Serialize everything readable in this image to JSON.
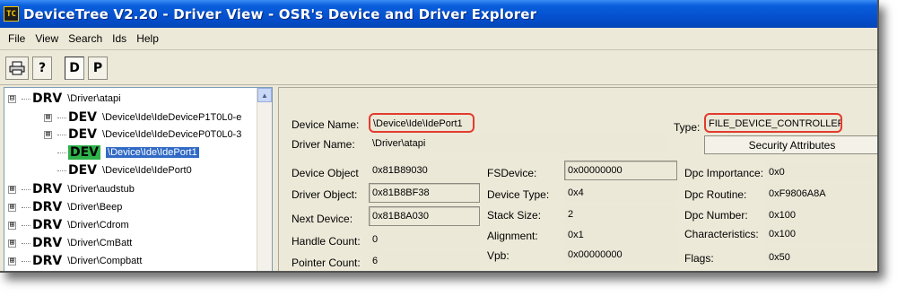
{
  "window": {
    "icon_text": "TC",
    "title": "DeviceTree V2.20 - Driver View - OSR's Device and Driver Explorer"
  },
  "menu": [
    "File",
    "View",
    "Search",
    "Ids",
    "Help"
  ],
  "toolbar": {
    "print_icon": "printer-icon",
    "help_label": "?",
    "driver_view_label": "D",
    "pnp_view_label": "P"
  },
  "tree": {
    "items": [
      {
        "expander": "⊟",
        "kind": "DRV",
        "path": "\\Driver\\atapi"
      },
      {
        "expander": "⊞",
        "kind": "DEV",
        "path": "\\Device\\Ide\\IdeDeviceP1T0L0-e"
      },
      {
        "expander": "⊞",
        "kind": "DEV",
        "path": "\\Device\\Ide\\IdeDeviceP0T0L0-3"
      },
      {
        "expander": "",
        "kind": "DEV",
        "path": "\\Device\\Ide\\IdePort1"
      },
      {
        "expander": "",
        "kind": "DEV",
        "path": "\\Device\\Ide\\IdePort0"
      },
      {
        "expander": "⊞",
        "kind": "DRV",
        "path": "\\Driver\\audstub"
      },
      {
        "expander": "⊞",
        "kind": "DRV",
        "path": "\\Driver\\Beep"
      },
      {
        "expander": "⊞",
        "kind": "DRV",
        "path": "\\Driver\\Cdrom"
      },
      {
        "expander": "⊞",
        "kind": "DRV",
        "path": "\\Driver\\CmBatt"
      },
      {
        "expander": "⊞",
        "kind": "DRV",
        "path": "\\Driver\\Compbatt"
      }
    ],
    "selected_index": 3
  },
  "details": {
    "device_name_label": "Device Name:",
    "device_name": "\\Device\\Ide\\IdePort1",
    "driver_name_label": "Driver Name:",
    "driver_name": "\\Driver\\atapi",
    "type_label": "Type:",
    "type": "FILE_DEVICE_CONTROLLER",
    "security_button": "Security Attributes",
    "device_object_label": "Device Object",
    "device_object": "0x81B89030",
    "driver_object_label": "Driver Object:",
    "driver_object": "0x81B8BF38",
    "next_device_label": "Next Device:",
    "next_device": "0x81B8A030",
    "handle_count_label": "Handle Count:",
    "handle_count": "0",
    "pointer_count_label": "Pointer Count:",
    "pointer_count": "6",
    "fsdevice_label": "FSDevice:",
    "fsdevice": "0x00000000",
    "device_type_label": "Device Type:",
    "device_type": "0x4",
    "stack_size_label": "Stack Size:",
    "stack_size": "2",
    "alignment_label": "Alignment:",
    "alignment": "0x1",
    "vpb_label": "Vpb:",
    "vpb": "0x00000000",
    "dpc_importance_label": "Dpc Importance:",
    "dpc_importance": "0x0",
    "dpc_routine_label": "Dpc Routine:",
    "dpc_routine": "0xF9806A8A",
    "dpc_number_label": "Dpc Number:",
    "dpc_number": "0x100",
    "characteristics_label": "Characteristics:",
    "characteristics": "0x100",
    "flags_label": "Flags:",
    "flags": "0x50"
  },
  "colors": {
    "highlight": "#e23b2e",
    "dev_selected": "#2eb24a",
    "selection": "#316ac5",
    "titlebar": "#0550cf"
  }
}
